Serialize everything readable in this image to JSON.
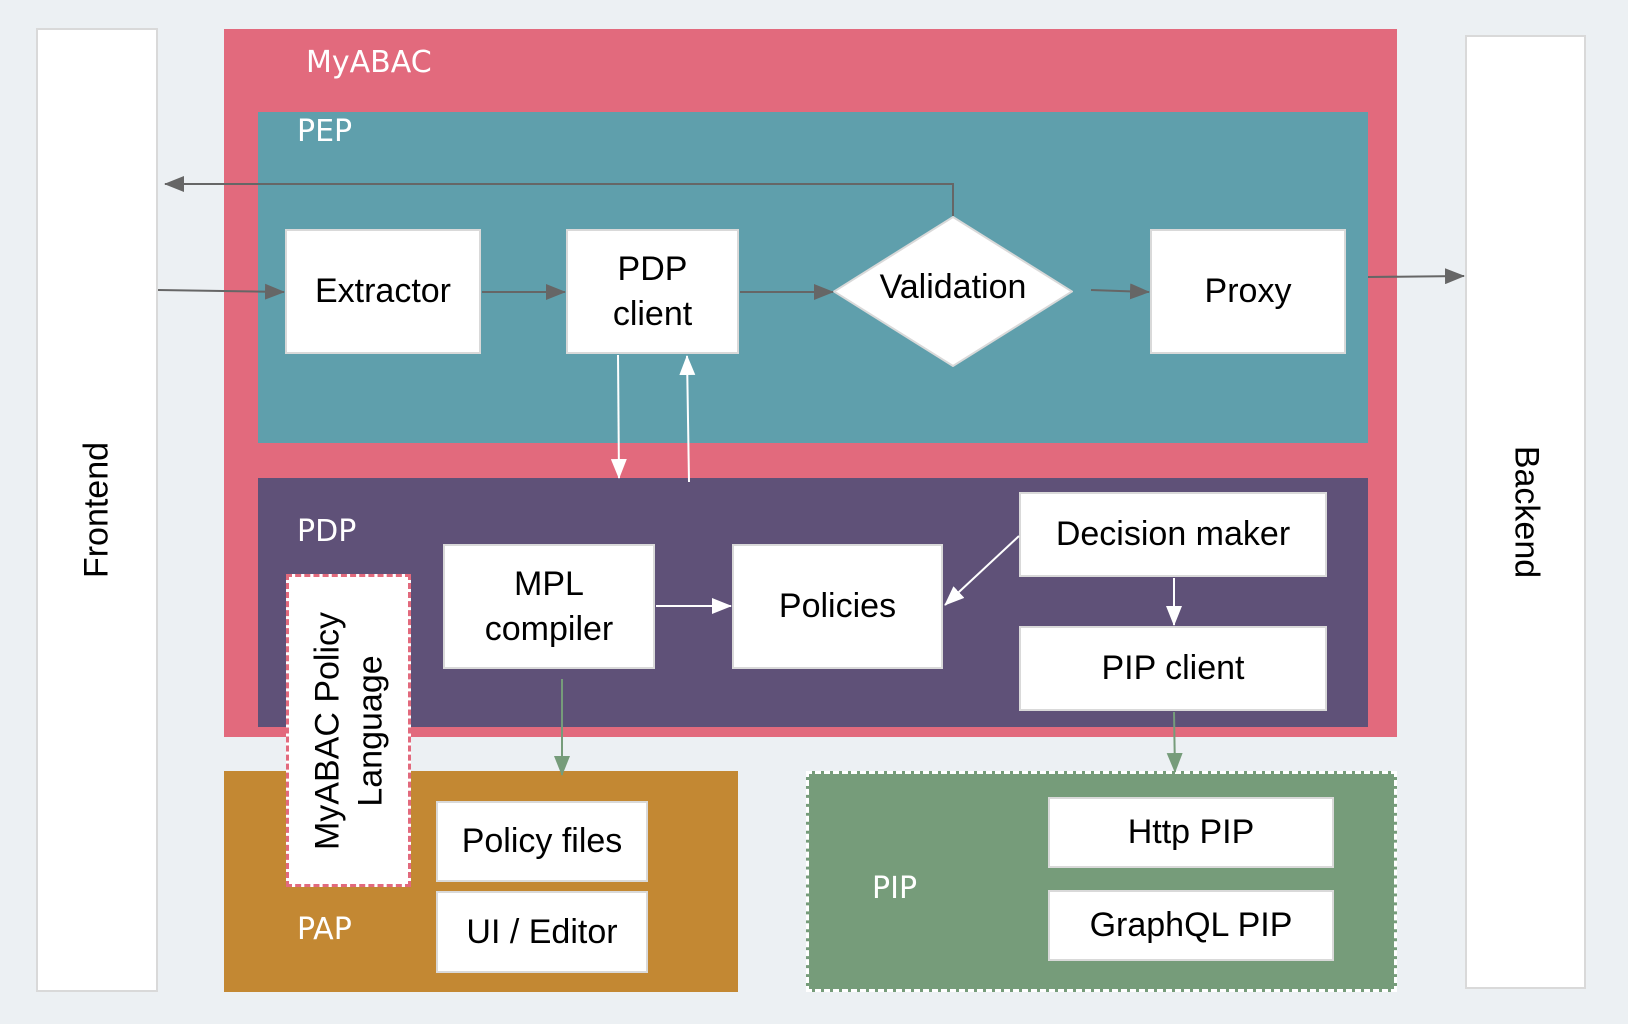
{
  "diagram": {
    "external": {
      "frontend": "Frontend",
      "backend": "Backend"
    },
    "myabac": {
      "label": "MyABAC",
      "pep": {
        "label": "PEP",
        "extractor": "Extractor",
        "pdp_client_line1": "PDP",
        "pdp_client_line2": "client",
        "validation": "Validation",
        "proxy": "Proxy"
      },
      "pdp": {
        "label": "PDP",
        "mpl_compiler_line1": "MPL",
        "mpl_compiler_line2": "compiler",
        "policies": "Policies",
        "decision_maker": "Decision maker",
        "pip_client": "PIP client"
      }
    },
    "policy_language": {
      "line1": "MyABAC Policy",
      "line2": "Language"
    },
    "pap": {
      "label": "PAP",
      "policy_files": "Policy files",
      "ui_editor": "UI / Editor"
    },
    "pip": {
      "label": "PIP",
      "http_pip": "Http PIP",
      "graphql_pip": "GraphQL PIP"
    },
    "colors": {
      "background": "#ECF0F3",
      "myabac": "#E26A7D",
      "pep": "#5F9FAC",
      "pdp": "#5F5178",
      "pap": "#C38833",
      "pip": "#769C7A",
      "arrow_dark": "#666666",
      "arrow_light": "#FFFFFF",
      "arrow_green": "#769C7A"
    }
  }
}
